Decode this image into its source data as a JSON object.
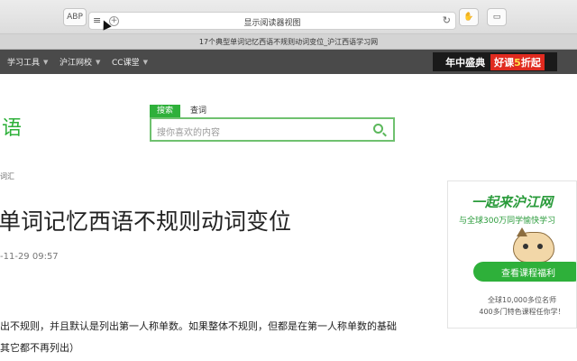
{
  "browser": {
    "address_title": "显示阅读器视图",
    "tab_title": "17个典型单词记忆西语不规则动词变位_沪江西语学习网"
  },
  "nav": {
    "items": [
      "学习工具",
      "沪江网校",
      "CC课堂"
    ],
    "promo_left": "年中盛典",
    "promo_right_a": "好课",
    "promo_right_num": "5",
    "promo_right_b": "折起"
  },
  "logo_text": "语",
  "search": {
    "tabs": [
      "搜索",
      "查词"
    ],
    "placeholder": "搜你喜欢的内容"
  },
  "article": {
    "breadcrumb": "词汇",
    "title": "单词记忆西语不规则动词变位",
    "date": "-11-29 09:57",
    "line1": "出不规则，并且默认是列出第一人称单数。如果整体不规则，但都是在第一人称单数的基础",
    "line2": "其它都不再列出）"
  },
  "ad": {
    "slogan": "一起来沪江网",
    "subtitle": "与全球300万同学愉快学习",
    "button": "查看课程福利",
    "note1": "全球10,000多位名师",
    "note2": "400多门特色课程任你学！"
  }
}
